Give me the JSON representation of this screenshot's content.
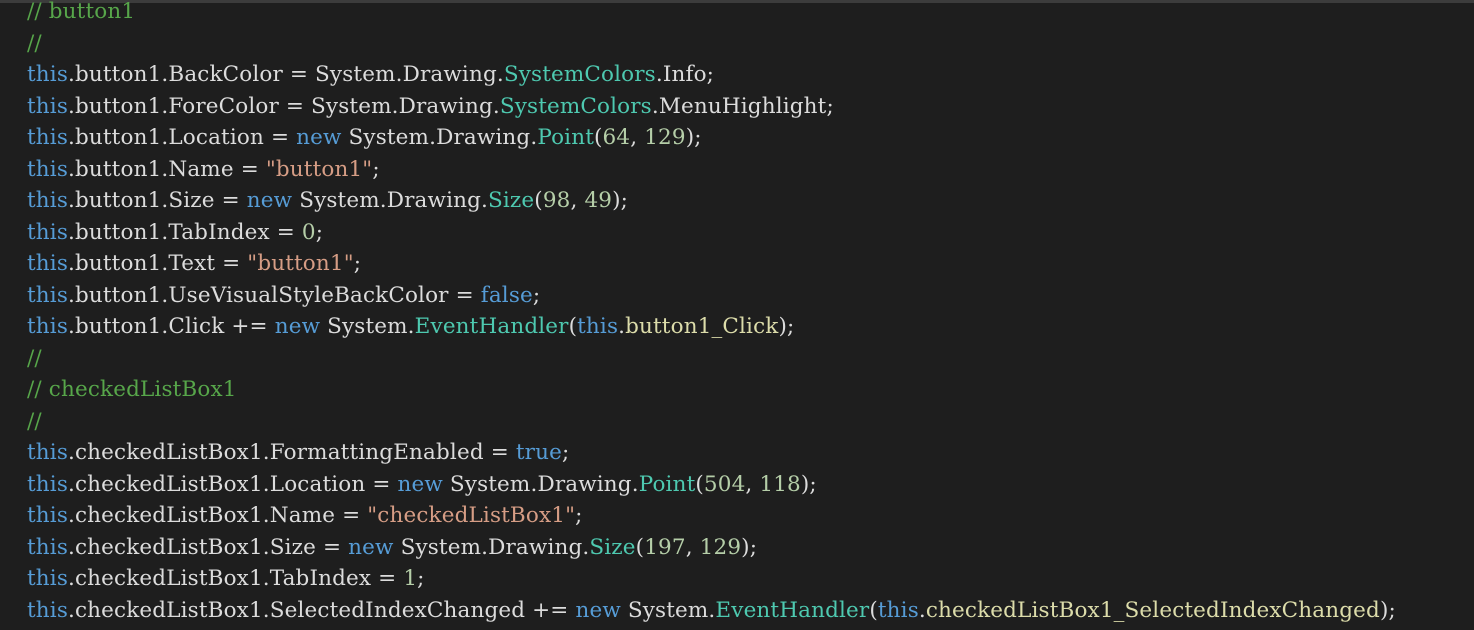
{
  "colors": {
    "background": "#1e1e1e",
    "plain": "#dcdcdc",
    "keyword": "#569cd6",
    "comment": "#57a64a",
    "type": "#4ec9b0",
    "string": "#d69d85",
    "number": "#b5cea8",
    "method": "#dcdcaa"
  },
  "code": {
    "lines": [
      [
        [
          "comment",
          "// button1"
        ]
      ],
      [
        [
          "comment",
          "//"
        ]
      ],
      [
        [
          "keyword",
          "this"
        ],
        [
          "plain",
          ".button1.BackColor = System.Drawing."
        ],
        [
          "type",
          "SystemColors"
        ],
        [
          "plain",
          ".Info;"
        ]
      ],
      [
        [
          "keyword",
          "this"
        ],
        [
          "plain",
          ".button1.ForeColor = System.Drawing."
        ],
        [
          "type",
          "SystemColors"
        ],
        [
          "plain",
          ".MenuHighlight;"
        ]
      ],
      [
        [
          "keyword",
          "this"
        ],
        [
          "plain",
          ".button1.Location = "
        ],
        [
          "keyword",
          "new"
        ],
        [
          "plain",
          " System.Drawing."
        ],
        [
          "type",
          "Point"
        ],
        [
          "plain",
          "("
        ],
        [
          "number",
          "64"
        ],
        [
          "plain",
          ", "
        ],
        [
          "number",
          "129"
        ],
        [
          "plain",
          ");"
        ]
      ],
      [
        [
          "keyword",
          "this"
        ],
        [
          "plain",
          ".button1.Name = "
        ],
        [
          "string",
          "\"button1\""
        ],
        [
          "plain",
          ";"
        ]
      ],
      [
        [
          "keyword",
          "this"
        ],
        [
          "plain",
          ".button1.Size = "
        ],
        [
          "keyword",
          "new"
        ],
        [
          "plain",
          " System.Drawing."
        ],
        [
          "type",
          "Size"
        ],
        [
          "plain",
          "("
        ],
        [
          "number",
          "98"
        ],
        [
          "plain",
          ", "
        ],
        [
          "number",
          "49"
        ],
        [
          "plain",
          ");"
        ]
      ],
      [
        [
          "keyword",
          "this"
        ],
        [
          "plain",
          ".button1.TabIndex = "
        ],
        [
          "number",
          "0"
        ],
        [
          "plain",
          ";"
        ]
      ],
      [
        [
          "keyword",
          "this"
        ],
        [
          "plain",
          ".button1.Text = "
        ],
        [
          "string",
          "\"button1\""
        ],
        [
          "plain",
          ";"
        ]
      ],
      [
        [
          "keyword",
          "this"
        ],
        [
          "plain",
          ".button1.UseVisualStyleBackColor = "
        ],
        [
          "keyword",
          "false"
        ],
        [
          "plain",
          ";"
        ]
      ],
      [
        [
          "keyword",
          "this"
        ],
        [
          "plain",
          ".button1.Click += "
        ],
        [
          "keyword",
          "new"
        ],
        [
          "plain",
          " System."
        ],
        [
          "type",
          "EventHandler"
        ],
        [
          "plain",
          "("
        ],
        [
          "keyword",
          "this"
        ],
        [
          "plain",
          "."
        ],
        [
          "method",
          "button1_Click"
        ],
        [
          "plain",
          ");"
        ]
      ],
      [
        [
          "comment",
          "//"
        ]
      ],
      [
        [
          "comment",
          "// checkedListBox1"
        ]
      ],
      [
        [
          "comment",
          "//"
        ]
      ],
      [
        [
          "keyword",
          "this"
        ],
        [
          "plain",
          ".checkedListBox1.FormattingEnabled = "
        ],
        [
          "keyword",
          "true"
        ],
        [
          "plain",
          ";"
        ]
      ],
      [
        [
          "keyword",
          "this"
        ],
        [
          "plain",
          ".checkedListBox1.Location = "
        ],
        [
          "keyword",
          "new"
        ],
        [
          "plain",
          " System.Drawing."
        ],
        [
          "type",
          "Point"
        ],
        [
          "plain",
          "("
        ],
        [
          "number",
          "504"
        ],
        [
          "plain",
          ", "
        ],
        [
          "number",
          "118"
        ],
        [
          "plain",
          ");"
        ]
      ],
      [
        [
          "keyword",
          "this"
        ],
        [
          "plain",
          ".checkedListBox1.Name = "
        ],
        [
          "string",
          "\"checkedListBox1\""
        ],
        [
          "plain",
          ";"
        ]
      ],
      [
        [
          "keyword",
          "this"
        ],
        [
          "plain",
          ".checkedListBox1.Size = "
        ],
        [
          "keyword",
          "new"
        ],
        [
          "plain",
          " System.Drawing."
        ],
        [
          "type",
          "Size"
        ],
        [
          "plain",
          "("
        ],
        [
          "number",
          "197"
        ],
        [
          "plain",
          ", "
        ],
        [
          "number",
          "129"
        ],
        [
          "plain",
          ");"
        ]
      ],
      [
        [
          "keyword",
          "this"
        ],
        [
          "plain",
          ".checkedListBox1.TabIndex = "
        ],
        [
          "number",
          "1"
        ],
        [
          "plain",
          ";"
        ]
      ],
      [
        [
          "keyword",
          "this"
        ],
        [
          "plain",
          ".checkedListBox1.SelectedIndexChanged += "
        ],
        [
          "keyword",
          "new"
        ],
        [
          "plain",
          " System."
        ],
        [
          "type",
          "EventHandler"
        ],
        [
          "plain",
          "("
        ],
        [
          "keyword",
          "this"
        ],
        [
          "plain",
          "."
        ],
        [
          "method",
          "checkedListBox1_SelectedIndexChanged"
        ],
        [
          "plain",
          ");"
        ]
      ]
    ]
  }
}
